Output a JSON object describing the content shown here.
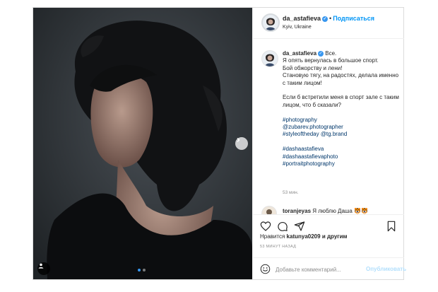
{
  "post": {
    "header": {
      "username": "da_astafieva",
      "separator": "•",
      "follow_label": "Подписаться",
      "location": "Kyiv, Ukraine"
    },
    "caption": {
      "username": "da_astafieva",
      "text": "Все.\nЯ опять вернулась в большое спорт.\nБой обжорству и лени!\nСтановую тягу, на радостях, делала именно с таким лицом!\n\nЕсли б встретили меня в спорт зале с таким лицом, что б сказали?\n\n",
      "tags_1": "#photography\n@zubarev.photographer\n#styleoftheday @tg.brand\n\n#dashaastafieva\n#dashaastafievaphoto\n#portraitphotography",
      "time": "53 мин."
    },
    "comment": {
      "username": "toranjeyas",
      "text": "Я люблю Даша 🐯🐯"
    },
    "likes": {
      "prefix": "Нравится",
      "user": "katunya0209",
      "suffix": "и другим"
    },
    "posted_ago": "53 МИНУТ НАЗАД",
    "add_comment": {
      "placeholder": "Добавьте комментарий...",
      "publish_label": "Опубликовать"
    },
    "carousel": {
      "count": 2,
      "active_index": 0
    },
    "colors": {
      "accent": "#0095f6",
      "verified": "#3897f0",
      "muted": "#8e8e8e",
      "publish_disabled": "#b2dffc"
    },
    "icons": [
      "heart-icon",
      "comment-icon",
      "share-icon",
      "bookmark-icon",
      "next-arrow-icon",
      "user-tag-icon",
      "emoji-icon",
      "verified-icon"
    ]
  }
}
